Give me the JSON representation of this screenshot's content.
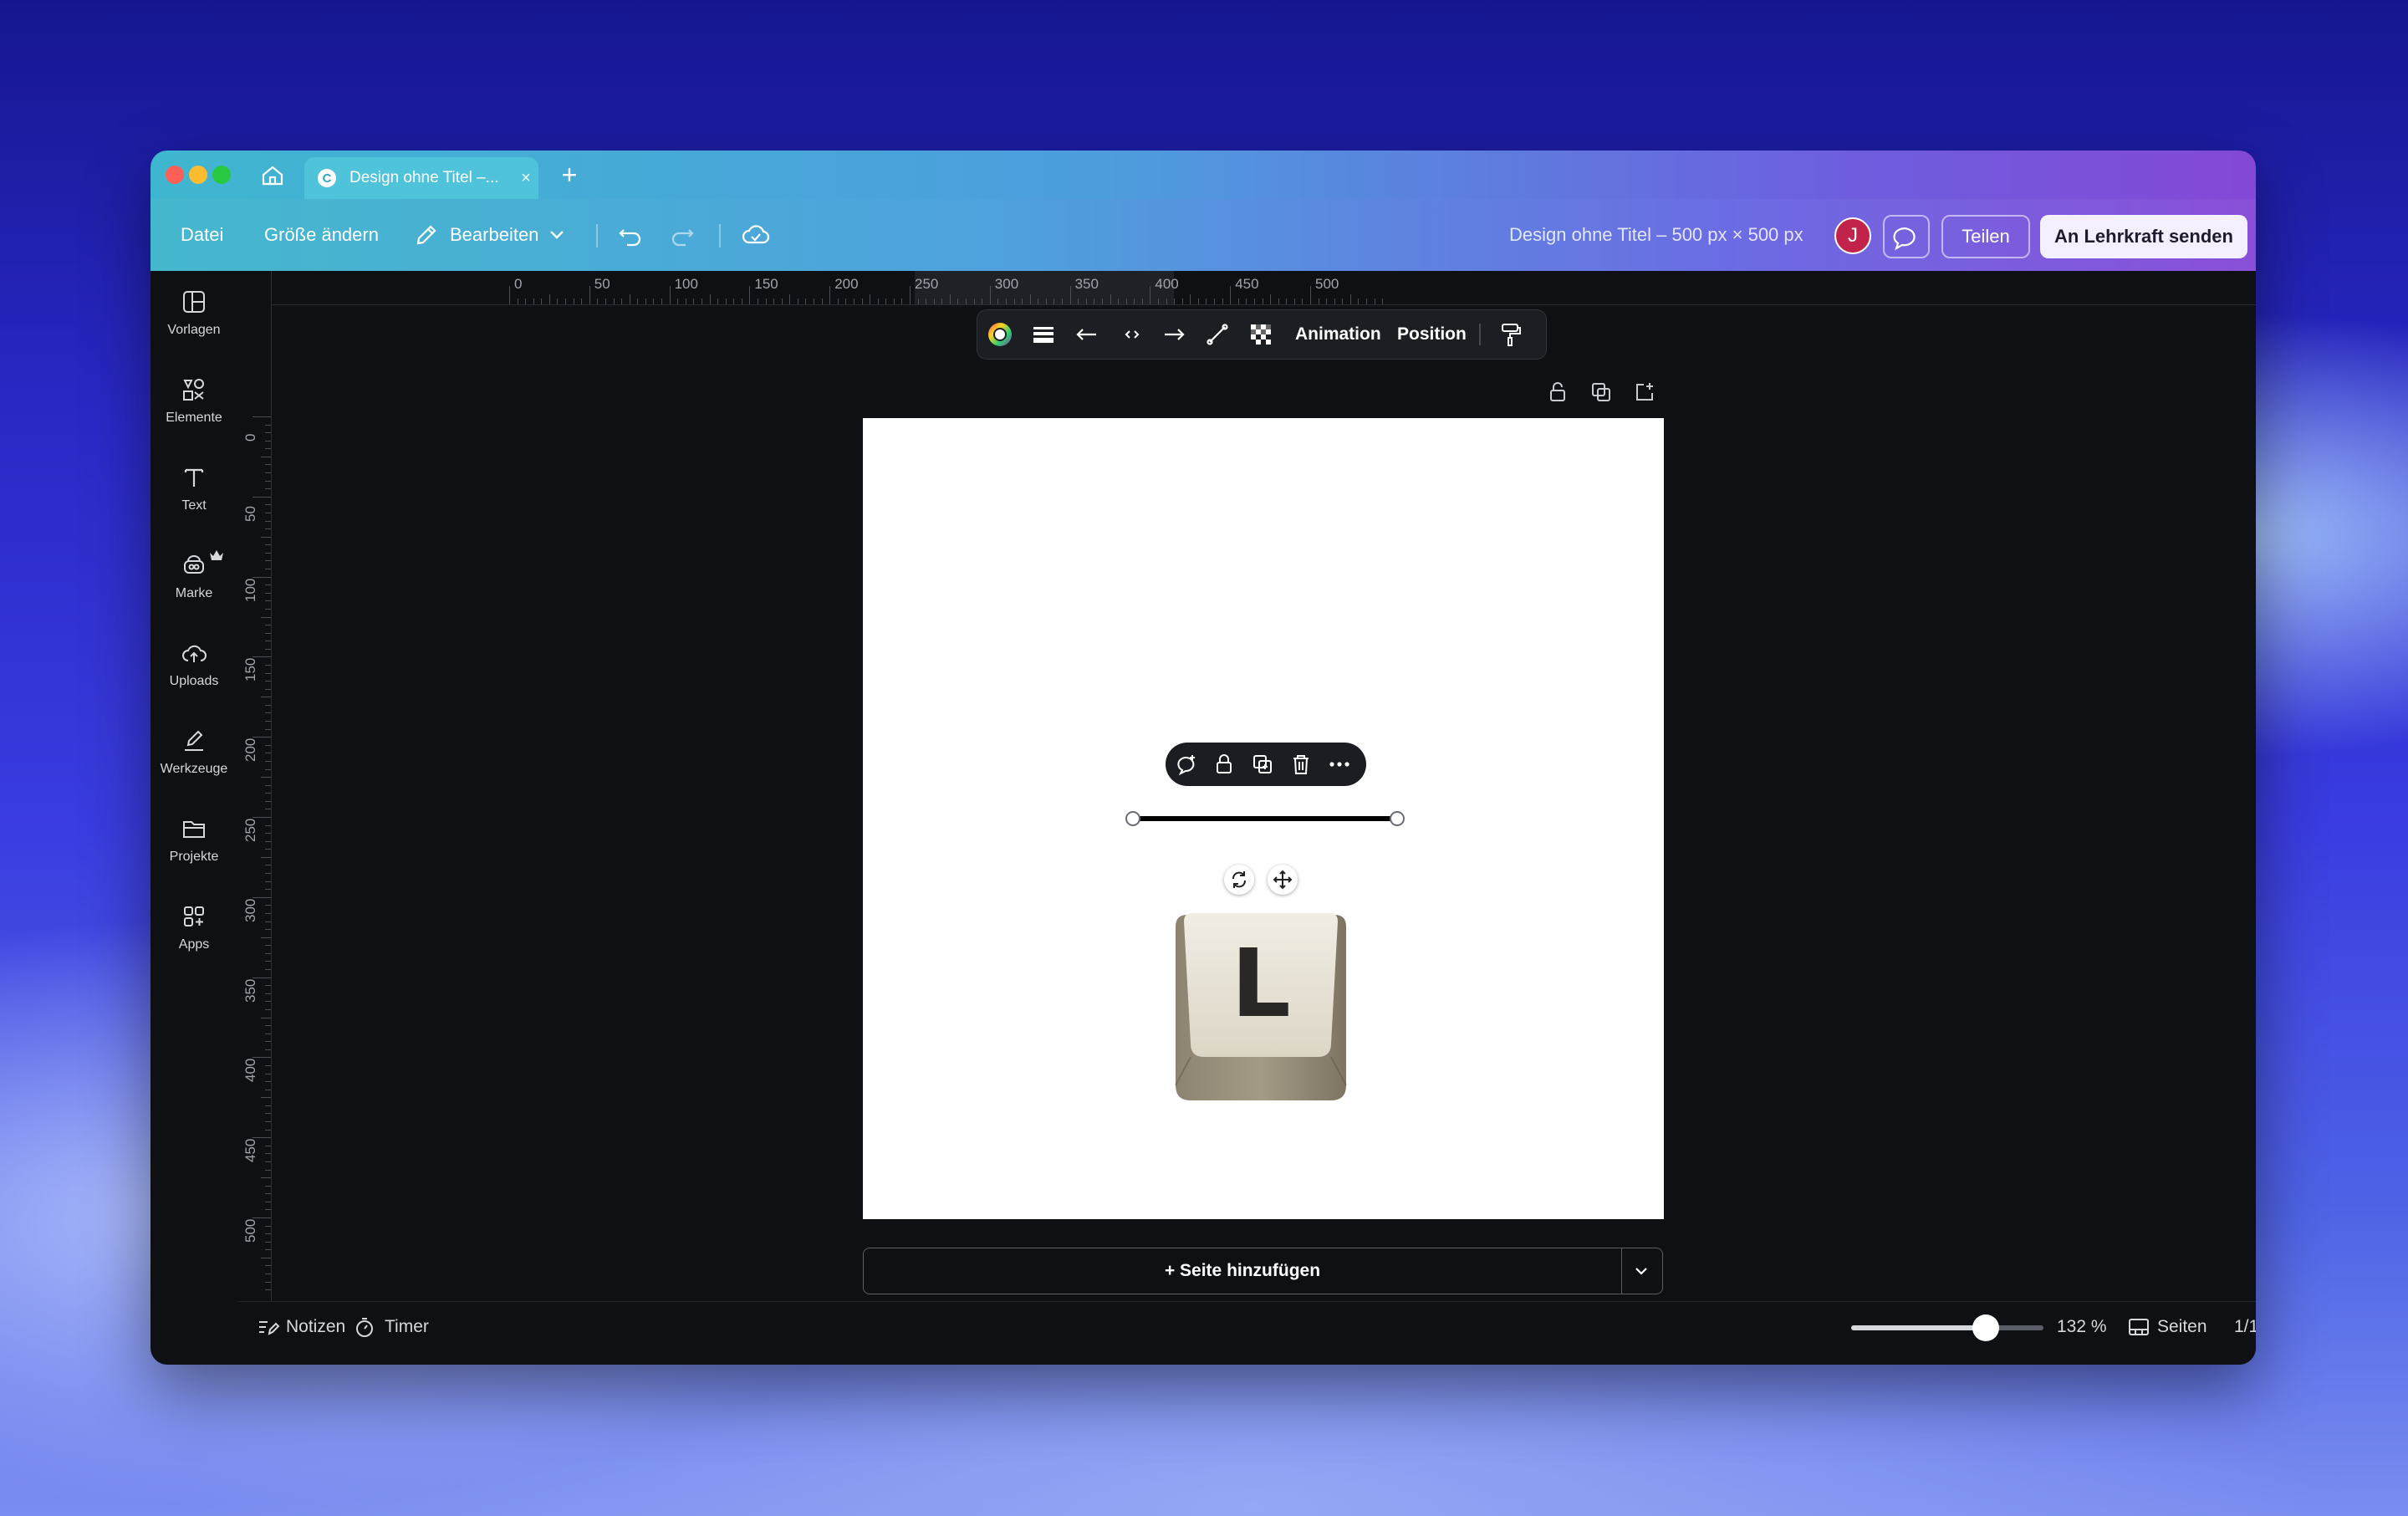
{
  "tab": {
    "title": "Design ohne Titel –...",
    "close": "×",
    "new": "+"
  },
  "toolbar": {
    "file": "Datei",
    "resize": "Größe ändern",
    "edit": "Bearbeiten",
    "doc_title": "Design ohne Titel – 500 px × 500 px",
    "avatar_initial": "J",
    "share": "Teilen",
    "send": "An Lehrkraft senden"
  },
  "sidebar": {
    "items": [
      {
        "label": "Vorlagen",
        "icon": "templates-icon"
      },
      {
        "label": "Elemente",
        "icon": "elements-icon"
      },
      {
        "label": "Text",
        "icon": "text-icon"
      },
      {
        "label": "Marke",
        "icon": "brand-icon"
      },
      {
        "label": "Uploads",
        "icon": "cloud-upload-icon"
      },
      {
        "label": "Werkzeuge",
        "icon": "draw-tools-icon"
      },
      {
        "label": "Projekte",
        "icon": "folder-icon"
      },
      {
        "label": "Apps",
        "icon": "apps-icon"
      }
    ]
  },
  "ruler": {
    "top": [
      "0",
      "50",
      "100",
      "150",
      "200",
      "250",
      "300",
      "350",
      "400",
      "450",
      "500"
    ],
    "left": [
      "0",
      "50",
      "100",
      "150",
      "200",
      "250",
      "300",
      "350",
      "400",
      "450",
      "500"
    ]
  },
  "context_toolbar": {
    "animation": "Animation",
    "position": "Position"
  },
  "canvas": {
    "keycap_letter": "L"
  },
  "add_page": "+ Seite hinzufügen",
  "status": {
    "notes": "Notizen",
    "timer": "Timer",
    "zoom": "132 %",
    "zoom_fraction": 0.7,
    "pages": "Seiten",
    "page_count": "1/1"
  }
}
